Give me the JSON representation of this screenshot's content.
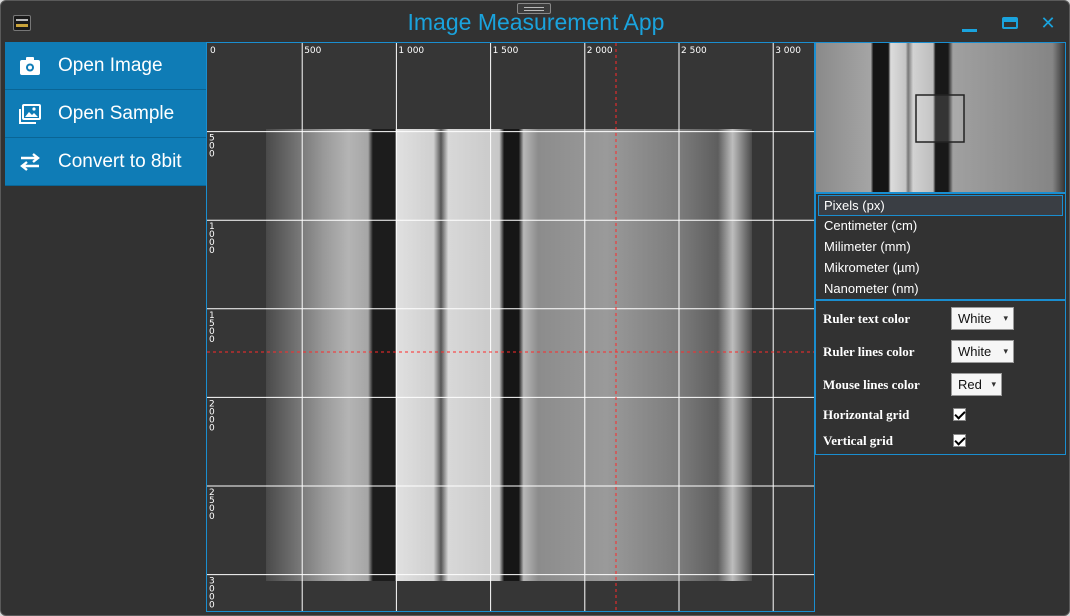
{
  "window": {
    "title": "Image Measurement App",
    "accent_color": "#1aa3dd",
    "menu_color": "#0f7cb6",
    "close_glyph": "✕"
  },
  "menu": [
    {
      "label": "Open Image",
      "icon": "camera-icon"
    },
    {
      "label": "Open Sample",
      "icon": "images-icon"
    },
    {
      "label": "Convert to 8bit",
      "icon": "swap-arrows-icon"
    }
  ],
  "canvas": {
    "top_ruler_labels": [
      "0",
      "500",
      "1 000",
      "1 500",
      "2 000",
      "2 500",
      "3 000"
    ],
    "left_ruler_labels": [
      "500",
      "1000",
      "1500",
      "2000",
      "2500",
      "3000"
    ],
    "ruler_text_color": "#ffffff",
    "ruler_line_color": "#ffffff",
    "mouse_line_color": "#ff2a2a"
  },
  "units": {
    "items": [
      "Pixels (px)",
      "Centimeter (cm)",
      "Milimeter (mm)",
      "Mikrometer (µm)",
      "Nanometer (nm)"
    ],
    "selected": "Pixels (px)"
  },
  "settings": {
    "ruler_text_color": {
      "label": "Ruler text color",
      "value": "White"
    },
    "ruler_lines_color": {
      "label": "Ruler lines color",
      "value": "White"
    },
    "mouse_lines_color": {
      "label": "Mouse lines color",
      "value": "Red"
    },
    "horizontal_grid": {
      "label": "Horizontal grid",
      "checked": true
    },
    "vertical_grid": {
      "label": "Vertical grid",
      "checked": true
    }
  }
}
